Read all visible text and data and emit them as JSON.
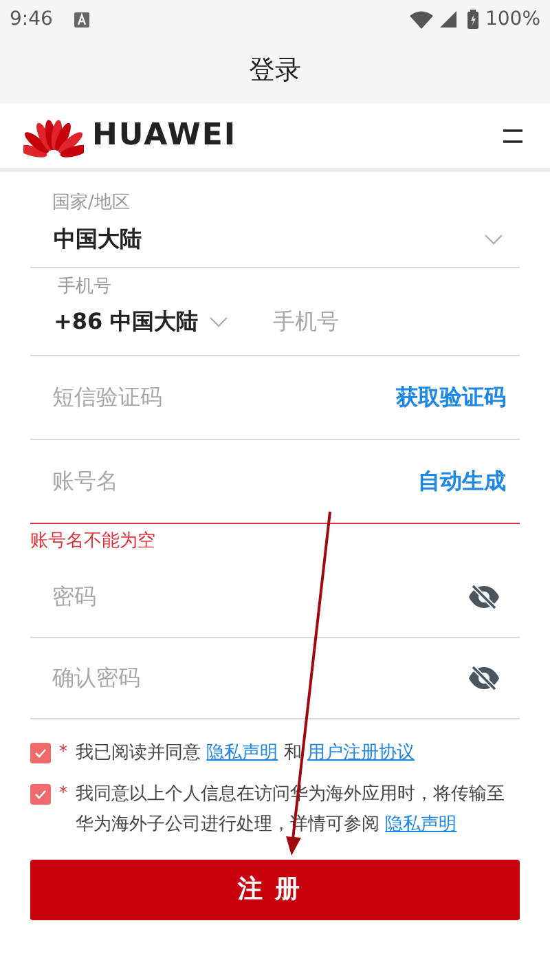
{
  "status_bar": {
    "time": "9:46",
    "battery": "100%"
  },
  "title": "登录",
  "header": {
    "brand": "HUAWEI"
  },
  "fields": [
    {
      "kind": "select",
      "label": "国家/地区",
      "value": "中国大陆"
    },
    {
      "kind": "phone",
      "label": "手机号",
      "code": "+86 中国大陆",
      "placeholder": "手机号"
    },
    {
      "kind": "action",
      "placeholder": "短信验证码",
      "action": "获取验证码"
    },
    {
      "kind": "action",
      "placeholder": "账号名",
      "action": "自动生成",
      "error": "账号名不能为空"
    },
    {
      "kind": "password",
      "placeholder": "密码"
    },
    {
      "kind": "password",
      "placeholder": "确认密码"
    }
  ],
  "agreements": [
    {
      "checked": true,
      "required": "*",
      "parts": [
        {
          "text": "我已阅读并同意 ",
          "link": false
        },
        {
          "text": "隐私声明",
          "link": true
        },
        {
          "text": " 和 ",
          "link": false
        },
        {
          "text": "用户注册协议",
          "link": true
        }
      ]
    },
    {
      "checked": true,
      "required": "*",
      "parts": [
        {
          "text": "我同意以上个人信息在访问华为海外应用时，将传输至华为海外子公司进行处理，详情可参阅 ",
          "link": false
        },
        {
          "text": "隐私声明",
          "link": true
        }
      ]
    }
  ],
  "register_button": "注册"
}
